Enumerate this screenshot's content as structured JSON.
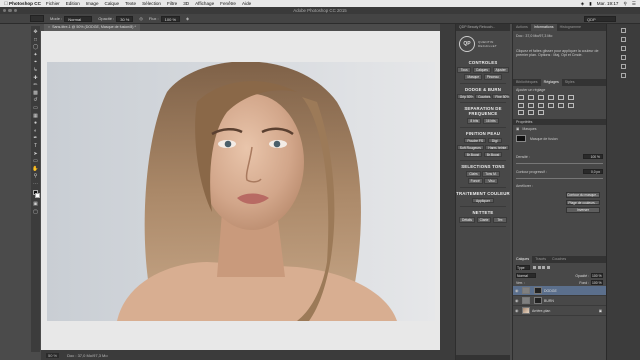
{
  "menubar": {
    "app_name": "Photoshop CC",
    "items": [
      "Fichier",
      "Edition",
      "Image",
      "Calque",
      "Texte",
      "Sélection",
      "Filtre",
      "3D",
      "Affichage",
      "Fenêtre",
      "Aide"
    ],
    "clock": "Mar. 19:17",
    "search_icon": "search-icon"
  },
  "titlebar": {
    "title": "Adobe Photoshop CC 2015"
  },
  "options": {
    "mode_label": "Mode :",
    "mode_value": "Normal",
    "opacity_label": "Opacité :",
    "opacity_value": "30 %",
    "flow_label": "Flux :",
    "flow_value": "100 %",
    "workspace": "QDP"
  },
  "document": {
    "tab_title": "Sans-titre-1 @ 50% (DODGE, Masque de fusion/8) *",
    "zoom": "50 %",
    "doc_size": "Doc : 37,0 Mo/97,3 Mo"
  },
  "plugin": {
    "header": "QDP Beauty Retouch...",
    "logo_initials": "QP",
    "logo_text_1": "QUENTIN",
    "logo_text_2": "DECAILLET",
    "sections": [
      {
        "title": "CONTROLES",
        "rows": [
          [
            "Tous",
            "Calques",
            "Ajuster"
          ],
          [
            "Masque",
            "Pinceau"
          ]
        ]
      },
      {
        "title": "DODGE & BURN",
        "rows": [
          [
            "Grip 50%",
            "Courbes",
            "Fine 50%"
          ]
        ]
      },
      {
        "title": "SEPARATION DE FREQUENCE",
        "rows": [
          [
            "8 bits",
            "16 bits"
          ]
        ]
      },
      {
        "title": "FINITION PEAU",
        "rows": [
          [
            "Poudre FS",
            "Digi"
          ],
          [
            "Soft Rougeurs",
            "Harm. teinte"
          ],
          [
            "Br.Boost",
            "Br.Boost"
          ]
        ]
      },
      {
        "title": "SELECTIONS TONS",
        "rows": [
          [
            "Clairs",
            "Tons M."
          ],
          [
            "Foncé",
            "Visu"
          ]
        ]
      },
      {
        "title": "TRAITEMENT COULEUR",
        "rows": [
          [
            "Appliquer"
          ]
        ]
      },
      {
        "title": "NETTETE",
        "rows": [
          [
            "Détails",
            "Clarte",
            "Tex"
          ]
        ]
      }
    ]
  },
  "right": {
    "top_tabs": [
      "Actions",
      "Informations",
      "Histogramme"
    ],
    "info_doc": "Doc : 37,0 Mo/97,3 Mo",
    "info_hint": "Cliquez et faites glisser pour appliquer la couleur de premier plan. Options : Maj, Opt et Cmde.",
    "adj_tabs": [
      "Bibliothèques",
      "Réglages",
      "Styles"
    ],
    "adj_hint": "Ajouter un réglage",
    "props_tab": "Propriétés",
    "props_title": "Masques",
    "mask_label": "Masque de fusion",
    "density_label": "Densité :",
    "density_value": "100 %",
    "feather_label": "Contour progressif :",
    "feather_value": "0,0 px",
    "refine_label": "Améliorer :",
    "btn_contour": "Contour du masque...",
    "btn_range": "Plage de couleurs...",
    "btn_invert": "Inverser",
    "layer_tabs": [
      "Calques",
      "Tracés",
      "Couches"
    ],
    "filter_label": "Type",
    "blend_mode": "Normal",
    "opacity_label": "Opacité :",
    "opacity_value": "100 %",
    "lock_label": "Verr. :",
    "fill_label": "Fond :",
    "fill_value": "100 %",
    "layers": [
      {
        "name": "DODGE",
        "selected": true
      },
      {
        "name": "BURN",
        "selected": false
      },
      {
        "name": "Arrière-plan",
        "selected": false
      }
    ]
  }
}
